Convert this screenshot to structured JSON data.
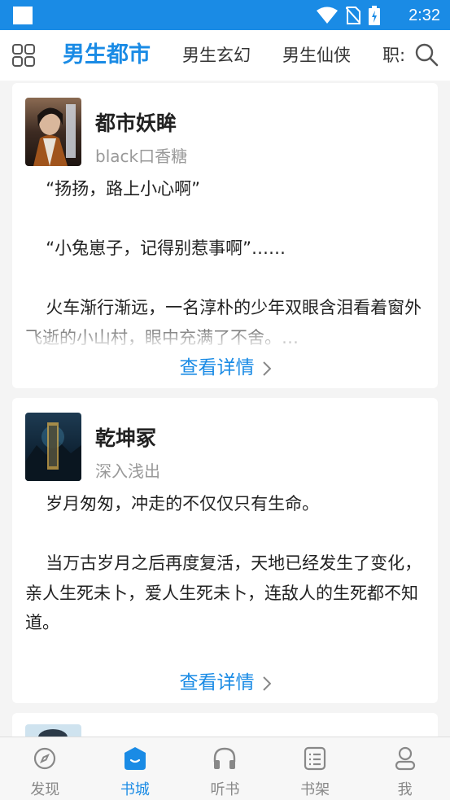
{
  "status_bar": {
    "time": "2:32"
  },
  "top_nav": {
    "tabs": [
      {
        "label": "男生都市",
        "active": true
      },
      {
        "label": "男生玄幻",
        "active": false
      },
      {
        "label": "男生仙侠",
        "active": false
      },
      {
        "label": "职:",
        "active": false
      }
    ]
  },
  "books": [
    {
      "title": "都市妖眸",
      "author": "black口香糖",
      "paragraphs": [
        "“扬扬，路上小心啊”",
        "",
        "“小兔崽子，记得别惹事啊”……",
        "",
        "火车渐行渐远，一名淳朴的少年双眼含泪看着窗外飞逝的小山村，眼中充满了不舍。…"
      ],
      "more_label": "查看详情"
    },
    {
      "title": "乾坤冢",
      "author": "深入浅出",
      "paragraphs": [
        "岁月匆匆，冲走的不仅仅只有生命。",
        "",
        "当万古岁月之后再度复活，天地已经发生了变化，亲人生死未卜，爱人生死未卜，连敌人的生死都不知道。",
        "",
        "…"
      ],
      "more_label": "查看详情"
    }
  ],
  "bottom_nav": {
    "items": [
      {
        "label": "发现",
        "icon": "compass-icon",
        "active": false
      },
      {
        "label": "书城",
        "icon": "store-icon",
        "active": true
      },
      {
        "label": "听书",
        "icon": "headphones-icon",
        "active": false
      },
      {
        "label": "书架",
        "icon": "bookshelf-icon",
        "active": false
      },
      {
        "label": "我",
        "icon": "profile-icon",
        "active": false
      }
    ]
  },
  "colors": {
    "accent": "#1a8be5",
    "text": "#222222",
    "muted": "#999999"
  }
}
